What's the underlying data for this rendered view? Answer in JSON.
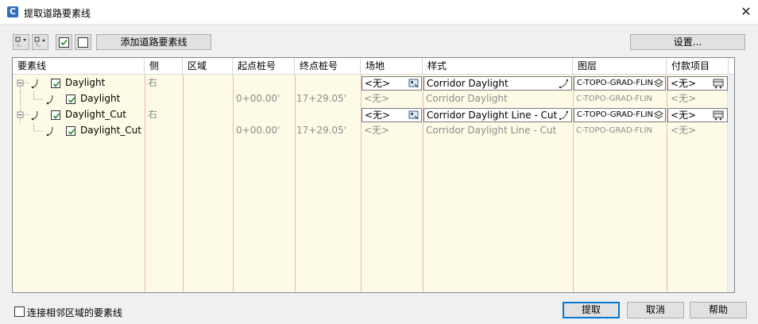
{
  "window": {
    "title": "提取道路要素线",
    "close_glyph": "✕"
  },
  "toolbar": {
    "add_button": "添加道路要素线",
    "settings_button": "设置..."
  },
  "columns": [
    "要素线",
    "侧",
    "区域",
    "起点桩号",
    "终点桩号",
    "场地",
    "样式",
    "图层",
    "付款项目"
  ],
  "rows": [
    {
      "name": "Daylight",
      "side": "右",
      "region": "",
      "start": "",
      "end": "",
      "site": "<无>",
      "style": "Corridor Daylight",
      "layer": "C-TOPO-GRAD-FLIN",
      "pay": "<无>",
      "level": 0,
      "editable": true
    },
    {
      "name": "Daylight",
      "side": "",
      "region": "",
      "start": "0+00.00'",
      "end": "17+29.05'",
      "site": "<无>",
      "style": "Corridor Daylight",
      "layer": "C-TOPO-GRAD-FLIN",
      "pay": "<无>",
      "level": 1,
      "editable": false
    },
    {
      "name": "Daylight_Cut",
      "side": "右",
      "region": "",
      "start": "",
      "end": "",
      "site": "<无>",
      "style": "Corridor Daylight Line - Cut",
      "layer": "C-TOPO-GRAD-FLIN",
      "pay": "<无>",
      "level": 0,
      "editable": true
    },
    {
      "name": "Daylight_Cut",
      "side": "",
      "region": "",
      "start": "0+00.00'",
      "end": "17+29.05'",
      "site": "<无>",
      "style": "Corridor Daylight Line - Cut",
      "layer": "C-TOPO-GRAD-FLIN",
      "pay": "<无>",
      "level": 1,
      "editable": false
    }
  ],
  "footer": {
    "connect_label": "连接相邻区域的要素线",
    "extract_button": "提取",
    "cancel_button": "取消",
    "help_button": "帮助"
  },
  "colors": {
    "grid_bg": "#fdfbe6",
    "col_line": "#e9b7b7",
    "default_border": "#0078d7"
  }
}
